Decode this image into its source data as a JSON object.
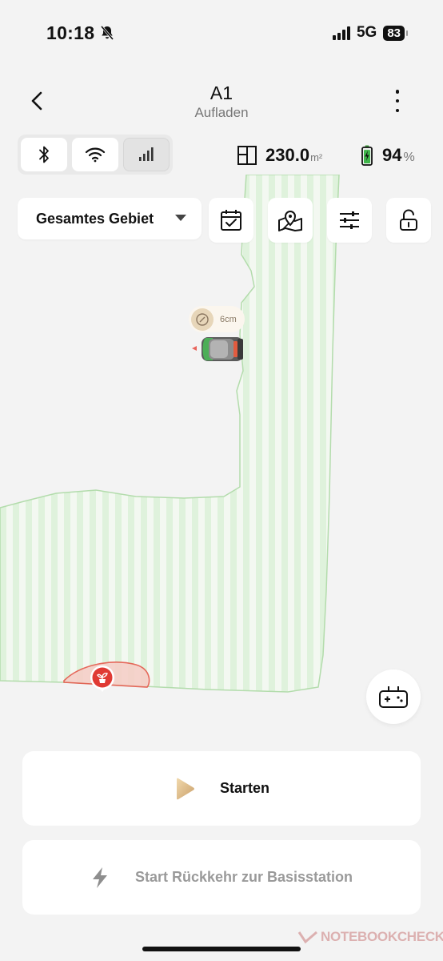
{
  "status_bar": {
    "time": "10:18",
    "network": "5G",
    "battery": "83",
    "icons": [
      "bell-muted-icon",
      "signal-icon",
      "battery-icon"
    ]
  },
  "header": {
    "title": "A1",
    "subtitle": "Aufladen",
    "icons": [
      "back-chevron-icon",
      "more-vertical-icon"
    ]
  },
  "connection": {
    "icons": [
      "bluetooth-icon",
      "wifi-icon",
      "cellular-icon"
    ],
    "active": "bluetooth"
  },
  "stats": {
    "area_value": "230.0",
    "area_unit": "m²",
    "battery_value": "94",
    "battery_unit": "%",
    "battery_level": 0.94,
    "icons": [
      "area-icon",
      "battery-charging-icon"
    ]
  },
  "toolbar": {
    "zone_label": "Gesamtes Gebiet",
    "icons": [
      "schedule-calendar-icon",
      "map-pin-icon",
      "settings-sliders-icon",
      "lock-open-icon"
    ]
  },
  "map": {
    "cut_height": "6cm",
    "colors": {
      "lawn_stripe_light": "#dff2dc",
      "lawn_stripe_dark": "#c7e7c2",
      "lawn_border": "#b3dcac",
      "mower_body": "#7a7a7a",
      "mower_accent": "#e15b3f",
      "obstacle": "#e03a34"
    },
    "icons": [
      "cut-height-icon",
      "mower-icon",
      "plant-obstacle-icon"
    ]
  },
  "actions": {
    "start_label": "Starten",
    "return_label": "Start Rückkehr zur Basisstation",
    "icons": [
      "play-icon",
      "lightning-icon",
      "gamepad-icon"
    ]
  },
  "watermark": "NOTEBOOKCHECK"
}
